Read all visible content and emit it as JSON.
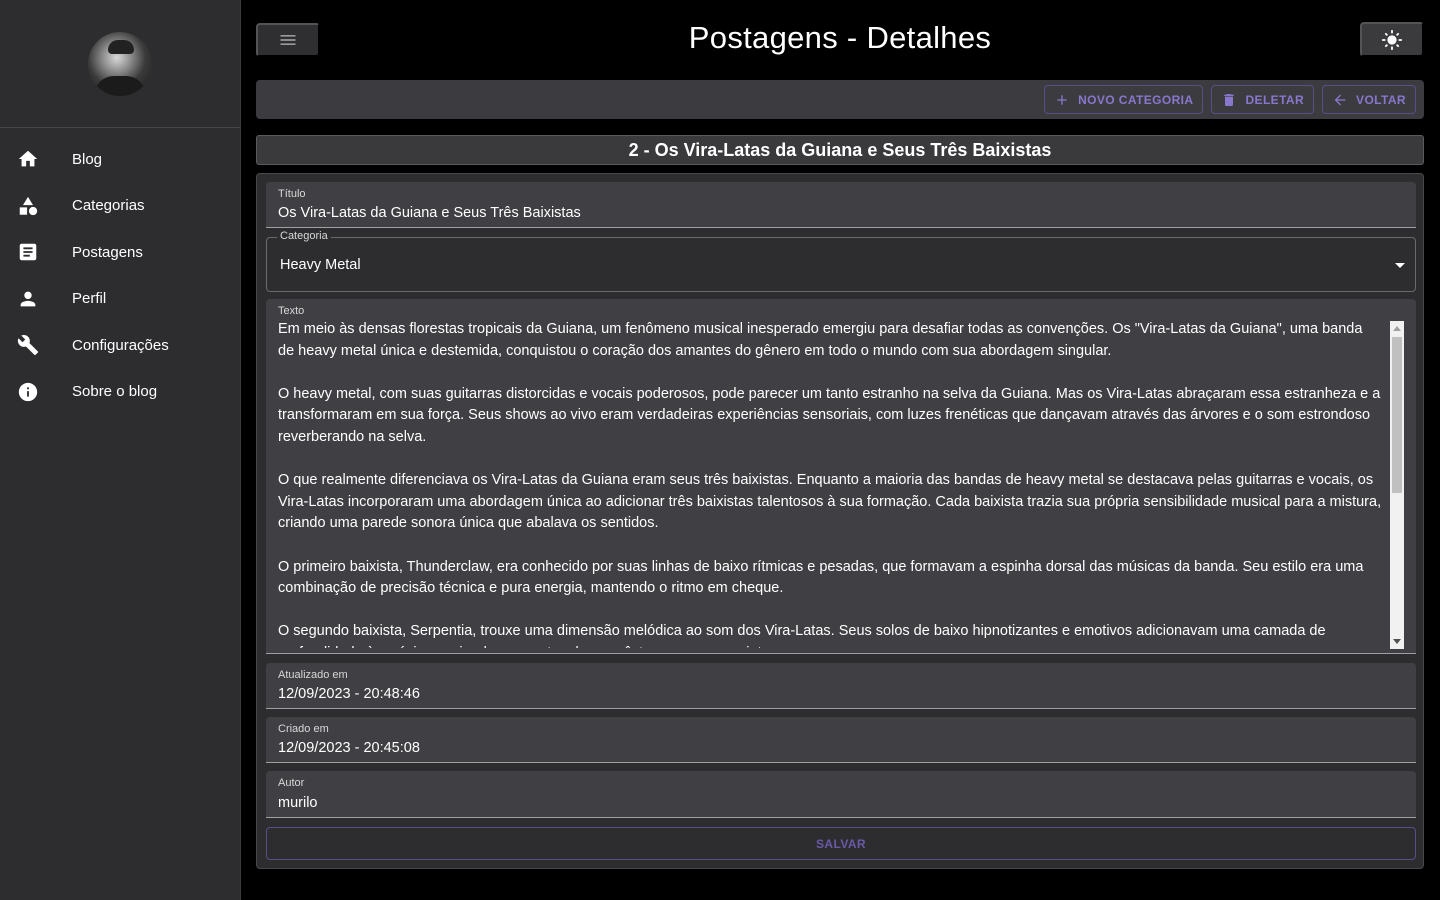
{
  "sidebar": {
    "items": [
      {
        "label": "Blog",
        "icon": "home-icon"
      },
      {
        "label": "Categorias",
        "icon": "category-shapes-icon"
      },
      {
        "label": "Postagens",
        "icon": "article-icon"
      },
      {
        "label": "Perfil",
        "icon": "person-icon"
      },
      {
        "label": "Configurações",
        "icon": "wrench-icon"
      },
      {
        "label": "Sobre o blog",
        "icon": "info-icon"
      }
    ]
  },
  "header": {
    "title": "Postagens - Detalhes"
  },
  "toolbar": {
    "new_category_label": "NOVO CATEGORIA",
    "delete_label": "DELETAR",
    "back_label": "VOLTAR"
  },
  "post": {
    "header": "2 - Os Vira-Latas da Guiana e Seus Três Baixistas"
  },
  "form": {
    "title_label": "Título",
    "title_value": "Os Vira-Latas da Guiana e Seus Três Baixistas",
    "category_label": "Categoria",
    "category_value": "Heavy Metal",
    "text_label": "Texto",
    "text_value": "Em meio às densas florestas tropicais da Guiana, um fenômeno musical inesperado emergiu para desafiar todas as convenções. Os \"Vira-Latas da Guiana\", uma banda de heavy metal única e destemida, conquistou o coração dos amantes do gênero em todo o mundo com sua abordagem singular.\n\nO heavy metal, com suas guitarras distorcidas e vocais poderosos, pode parecer um tanto estranho na selva da Guiana. Mas os Vira-Latas abraçaram essa estranheza e a transformaram em sua força. Seus shows ao vivo eram verdadeiras experiências sensoriais, com luzes frenéticas que dançavam através das árvores e o som estrondoso reverberando na selva.\n\nO que realmente diferenciava os Vira-Latas da Guiana eram seus três baixistas. Enquanto a maioria das bandas de heavy metal se destacava pelas guitarras e vocais, os Vira-Latas incorporaram uma abordagem única ao adicionar três baixistas talentosos à sua formação. Cada baixista trazia sua própria sensibilidade musical para a mistura, criando uma parede sonora única que abalava os sentidos.\n\nO primeiro baixista, Thunderclaw, era conhecido por suas linhas de baixo rítmicas e pesadas, que formavam a espinha dorsal das músicas da banda. Seu estilo era uma combinação de precisão técnica e pura energia, mantendo o ritmo em cheque.\n\nO segundo baixista, Serpentia, trouxe uma dimensão melódica ao som dos Vira-Latas. Seus solos de baixo hipnotizantes e emotivos adicionavam uma camada de profundidade às músicas, criando momentos de pura êxtase para os ouvintes.",
    "updated_label": "Atualizado em",
    "updated_value": "12/09/2023 - 20:48:46",
    "created_label": "Criado em",
    "created_value": "12/09/2023 - 20:45:08",
    "author_label": "Autor",
    "author_value": "murilo",
    "save_label": "SALVAR"
  },
  "colors": {
    "accent": "#8877cc",
    "background": "#000000",
    "sidebar": "#2d2d30",
    "field": "#404044"
  }
}
